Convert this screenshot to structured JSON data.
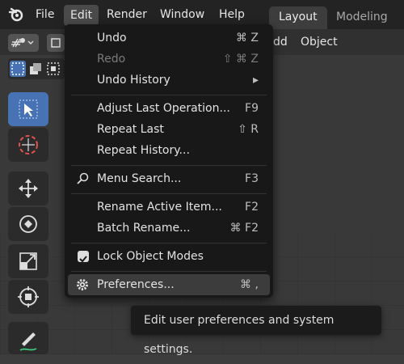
{
  "menubar": {
    "items": [
      "File",
      "Edit",
      "Render",
      "Window",
      "Help"
    ],
    "active": "Edit"
  },
  "workspace_tabs": [
    "Layout",
    "Modeling"
  ],
  "header": {
    "add_partial": "dd",
    "object": "Object"
  },
  "edit_menu": {
    "items": [
      {
        "label": "Undo",
        "shortcut": "⌘ Z",
        "disabled": false
      },
      {
        "label": "Redo",
        "shortcut": "⇧ ⌘ Z",
        "disabled": true
      },
      {
        "label": "Undo History",
        "shortcut": "▸",
        "disabled": false
      },
      {
        "label": "Adjust Last Operation...",
        "shortcut": "F9",
        "disabled": false
      },
      {
        "label": "Repeat Last",
        "shortcut": "⇧ R",
        "disabled": false
      },
      {
        "label": "Repeat History...",
        "shortcut": "",
        "disabled": false
      },
      {
        "label": "Menu Search...",
        "shortcut": "F3",
        "disabled": false
      },
      {
        "label": "Rename Active Item...",
        "shortcut": "F2",
        "disabled": false
      },
      {
        "label": "Batch Rename...",
        "shortcut": "⌘ F2",
        "disabled": false
      },
      {
        "label": "Lock Object Modes",
        "shortcut": "",
        "disabled": false
      },
      {
        "label": "Preferences...",
        "shortcut": "⌘ ,",
        "disabled": false
      }
    ]
  },
  "tooltip": "Edit user preferences and system settings.",
  "colors": {
    "accent": "#4772b3",
    "menu_bg": "#181818",
    "topbar_bg": "#232323"
  }
}
